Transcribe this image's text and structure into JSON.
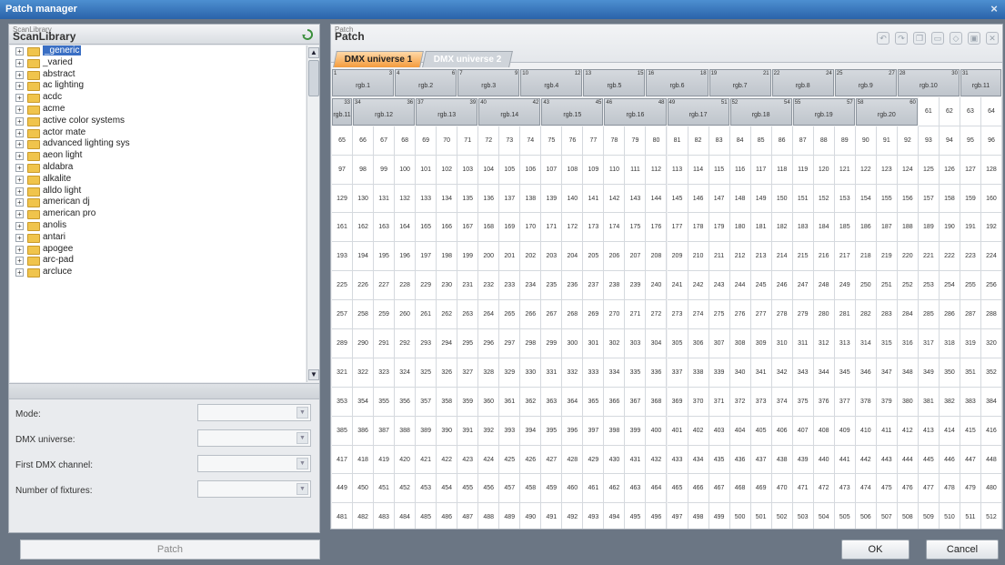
{
  "window": {
    "title": "Patch manager",
    "close_glyph": "×"
  },
  "scanlibrary": {
    "caption_small": "ScanLibrary",
    "caption": "ScanLibrary",
    "items": [
      {
        "label": "_generic",
        "selected": true
      },
      {
        "label": "_varied"
      },
      {
        "label": "abstract"
      },
      {
        "label": "ac lighting"
      },
      {
        "label": "acdc"
      },
      {
        "label": "acme"
      },
      {
        "label": "active color systems"
      },
      {
        "label": "actor mate"
      },
      {
        "label": "advanced lighting sys"
      },
      {
        "label": "aeon light"
      },
      {
        "label": "aldabra"
      },
      {
        "label": "alkalite"
      },
      {
        "label": "alldo light"
      },
      {
        "label": "american dj"
      },
      {
        "label": "american pro"
      },
      {
        "label": "anolis"
      },
      {
        "label": "antari"
      },
      {
        "label": "apogee"
      },
      {
        "label": "arc-pad"
      },
      {
        "label": "arcluce"
      }
    ],
    "expander_glyph": "+"
  },
  "form": {
    "mode_label": "Mode:",
    "dmx_universe_label": "DMX universe:",
    "first_channel_label": "First DMX channel:",
    "num_fixtures_label": "Number of fixtures:"
  },
  "patch_button": "Patch",
  "patch": {
    "caption_small": "Patch",
    "caption": "Patch",
    "tabs": [
      {
        "label": "DMX universe 1",
        "active": true
      },
      {
        "label": "DMX universe 2",
        "active": false
      }
    ],
    "fixtures": [
      {
        "name": "rgb.1",
        "start": 1,
        "end": 3
      },
      {
        "name": "rgb.2",
        "start": 4,
        "end": 6
      },
      {
        "name": "rgb.3",
        "start": 7,
        "end": 9
      },
      {
        "name": "rgb.4",
        "start": 10,
        "end": 12
      },
      {
        "name": "rgb.5",
        "start": 13,
        "end": 15
      },
      {
        "name": "rgb.6",
        "start": 16,
        "end": 18
      },
      {
        "name": "rgb.7",
        "start": 19,
        "end": 21
      },
      {
        "name": "rgb.8",
        "start": 22,
        "end": 24
      },
      {
        "name": "rgb.9",
        "start": 25,
        "end": 27
      },
      {
        "name": "rgb.10",
        "start": 28,
        "end": 30
      },
      {
        "name": "rgb.11",
        "start": 31,
        "end": 33
      },
      {
        "name": "rgb.12",
        "start": 34,
        "end": 36
      },
      {
        "name": "rgb.13",
        "start": 37,
        "end": 39
      },
      {
        "name": "rgb.14",
        "start": 40,
        "end": 42
      },
      {
        "name": "rgb.15",
        "start": 43,
        "end": 45
      },
      {
        "name": "rgb.16",
        "start": 46,
        "end": 48
      },
      {
        "name": "rgb.17",
        "start": 49,
        "end": 51
      },
      {
        "name": "rgb.18",
        "start": 52,
        "end": 54
      },
      {
        "name": "rgb.19",
        "start": 55,
        "end": 57
      },
      {
        "name": "rgb.20",
        "start": 58,
        "end": 60
      }
    ],
    "channels_per_row": 32,
    "total_channels": 512
  },
  "ok_button": "OK",
  "cancel_button": "Cancel"
}
